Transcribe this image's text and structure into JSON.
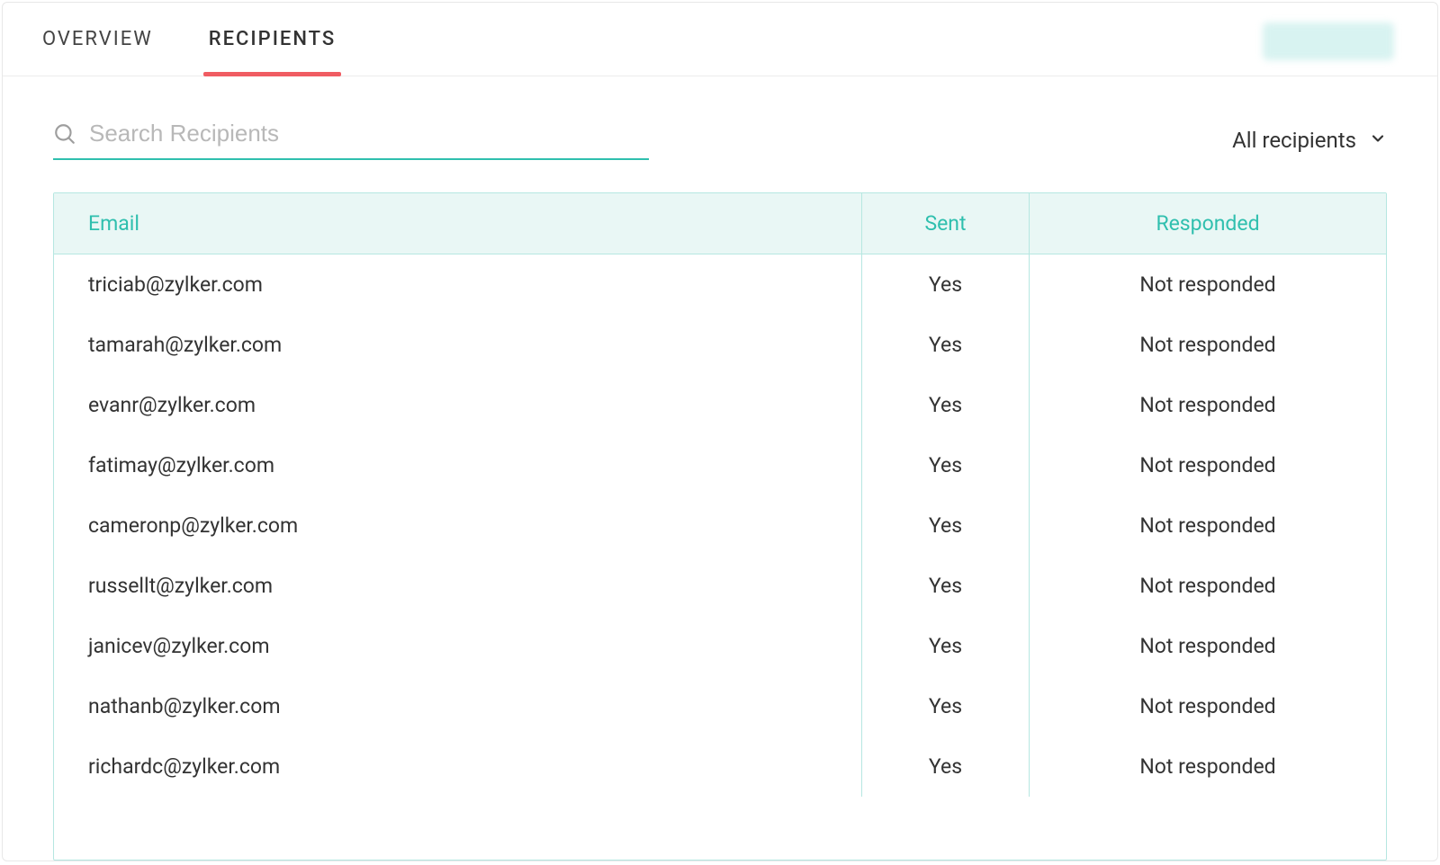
{
  "tabs": {
    "overview": "OVERVIEW",
    "recipients": "RECIPIENTS"
  },
  "search": {
    "placeholder": "Search Recipients",
    "value": ""
  },
  "filter": {
    "selected": "All recipients"
  },
  "table": {
    "headers": {
      "email": "Email",
      "sent": "Sent",
      "responded": "Responded"
    },
    "rows": [
      {
        "email": "triciab@zylker.com",
        "sent": "Yes",
        "responded": "Not responded"
      },
      {
        "email": "tamarah@zylker.com",
        "sent": "Yes",
        "responded": "Not responded"
      },
      {
        "email": "evanr@zylker.com",
        "sent": "Yes",
        "responded": "Not responded"
      },
      {
        "email": "fatimay@zylker.com",
        "sent": "Yes",
        "responded": "Not responded"
      },
      {
        "email": "cameronp@zylker.com",
        "sent": "Yes",
        "responded": "Not responded"
      },
      {
        "email": "russellt@zylker.com",
        "sent": "Yes",
        "responded": "Not responded"
      },
      {
        "email": "janicev@zylker.com",
        "sent": "Yes",
        "responded": "Not responded"
      },
      {
        "email": "nathanb@zylker.com",
        "sent": "Yes",
        "responded": "Not responded"
      },
      {
        "email": "richardc@zylker.com",
        "sent": "Yes",
        "responded": "Not responded"
      }
    ]
  }
}
